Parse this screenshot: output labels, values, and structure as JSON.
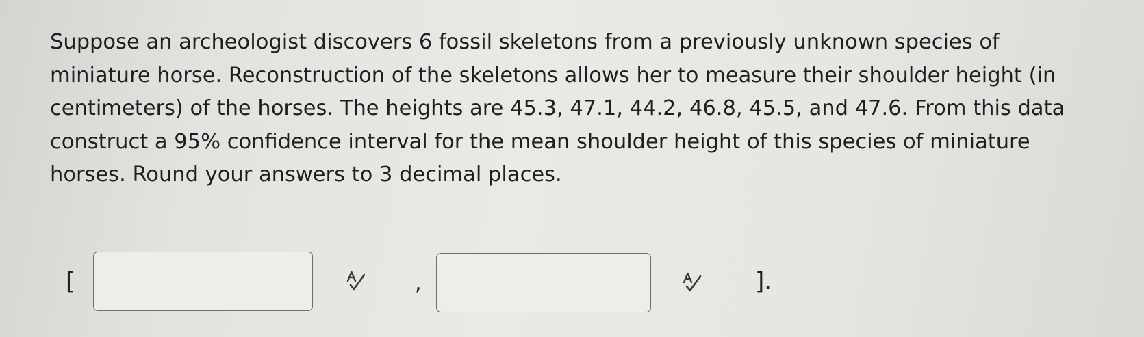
{
  "question": {
    "text": "Suppose an archeologist discovers 6 fossil skeletons from a previously unknown species of miniature horse. Reconstruction of the skeletons allows her to measure their shoulder height (in centimeters) of the horses. The heights are 45.3, 47.1, 44.2, 46.8, 45.5, and 47.6. From this data construct a 95% confidence interval for the mean shoulder height of this species of miniature horses. Round your answers to 3 decimal places."
  },
  "answer": {
    "open_bracket": "[",
    "separator": ",",
    "close_bracket": "].",
    "lower_bound": {
      "value": "",
      "placeholder": ""
    },
    "upper_bound": {
      "value": "",
      "placeholder": ""
    },
    "icons": {
      "lower_icon": "spell-check-icon",
      "upper_icon": "spell-check-icon"
    }
  },
  "colors": {
    "text": "#1f1f1f",
    "input_border": "#6e6e6e",
    "input_background": "#ededea",
    "icon": "#3a3a3a"
  }
}
